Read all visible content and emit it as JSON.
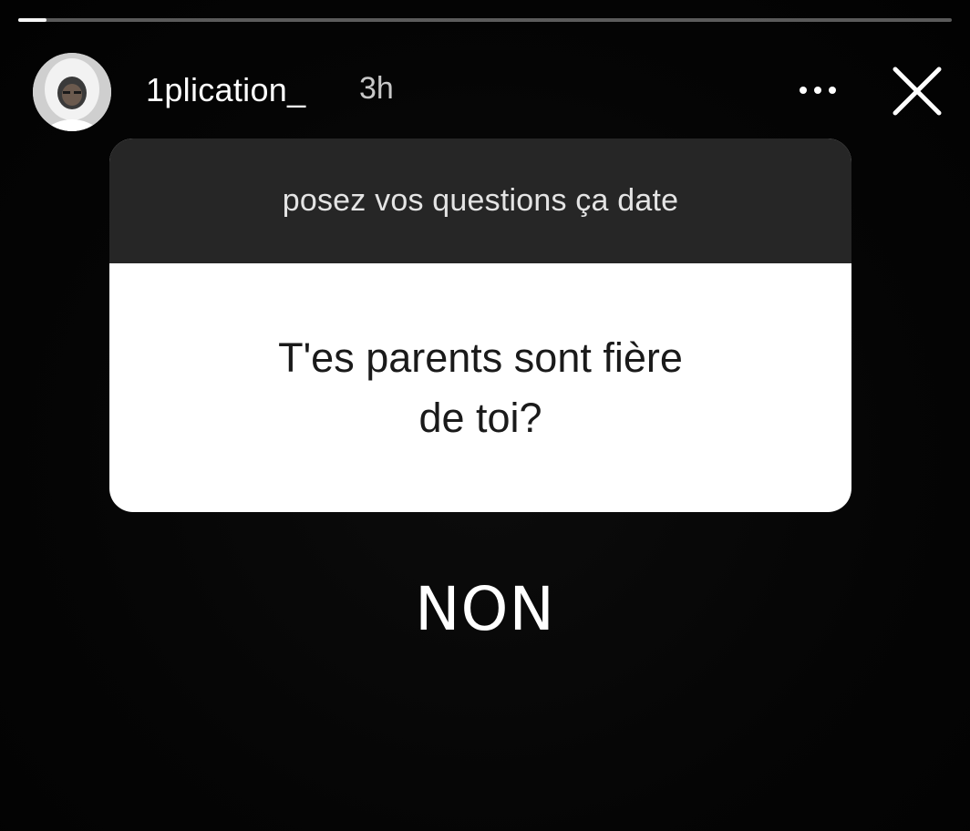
{
  "story": {
    "progress": {
      "segments": 1,
      "current": 1,
      "fraction_complete": 0.03
    },
    "header": {
      "username": "1plication_",
      "time_ago": "3h",
      "avatar_icon": "user-avatar",
      "more_icon": "more-horizontal-icon",
      "close_icon": "close-icon"
    },
    "question_card": {
      "prompt": "posez vos questions ça date",
      "question": "T'es parents sont fière\nde toi?"
    },
    "answer": "NON"
  },
  "colors": {
    "background": "#050505",
    "prompt_bar": "#262626",
    "card": "#ffffff",
    "text_light": "#ffffff",
    "text_dark": "#1a1a1a"
  }
}
